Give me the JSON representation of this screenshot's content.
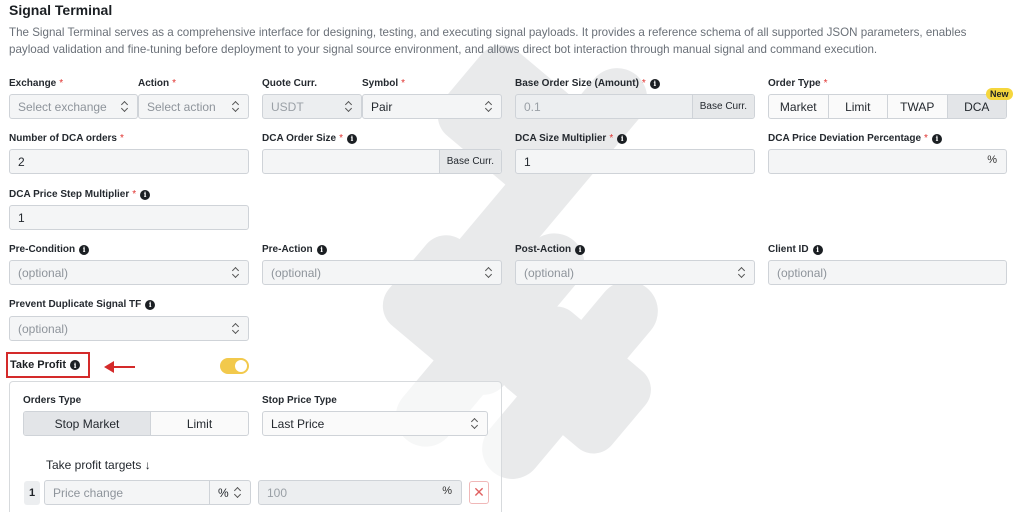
{
  "header": {
    "title": "Signal Terminal",
    "description": "The Signal Terminal serves as a comprehensive interface for designing, testing, and executing signal payloads. It provides a reference schema of all supported JSON parameters, enables payload validation and fine-tuning before deployment to your signal source environment, and allows direct bot interaction through manual signal and command execution."
  },
  "form": {
    "exchange": {
      "label": "Exchange",
      "required": "*",
      "placeholder": "Select exchange"
    },
    "action": {
      "label": "Action",
      "required": "*",
      "placeholder": "Select action"
    },
    "quote_curr": {
      "label": "Quote Curr.",
      "value": "USDT"
    },
    "symbol": {
      "label": "Symbol",
      "required": "*",
      "value": "Pair"
    },
    "base_order_size": {
      "label": "Base Order Size (Amount)",
      "required": "*",
      "placeholder": "0.1",
      "suffix": "Base Curr."
    },
    "order_type": {
      "label": "Order Type",
      "required": "*",
      "options": [
        "Market",
        "Limit",
        "TWAP",
        "DCA"
      ],
      "selected": "DCA",
      "badge": "New"
    },
    "dca_orders": {
      "label": "Number of DCA orders",
      "required": "*",
      "value": "2"
    },
    "dca_order_size": {
      "label": "DCA Order Size",
      "required": "*",
      "suffix": "Base Curr."
    },
    "dca_size_multiplier": {
      "label": "DCA Size Multiplier",
      "required": "*",
      "value": "1"
    },
    "dca_price_deviation": {
      "label": "DCA Price Deviation Percentage",
      "required": "*",
      "unit": "%"
    },
    "dca_price_step": {
      "label": "DCA Price Step Multiplier",
      "required": "*",
      "value": "1"
    },
    "pre_condition": {
      "label": "Pre-Condition",
      "placeholder": "(optional)"
    },
    "pre_action": {
      "label": "Pre-Action",
      "placeholder": "(optional)"
    },
    "post_action": {
      "label": "Post-Action",
      "placeholder": "(optional)"
    },
    "client_id": {
      "label": "Client ID",
      "placeholder": "(optional)"
    },
    "prevent_duplicate": {
      "label": "Prevent Duplicate Signal TF",
      "placeholder": "(optional)"
    }
  },
  "take_profit": {
    "label": "Take Profit",
    "enabled": true,
    "orders_type": {
      "label": "Orders Type",
      "options": [
        "Stop Market",
        "Limit"
      ],
      "selected": "Stop Market"
    },
    "stop_price_type": {
      "label": "Stop Price Type",
      "value": "Last Price"
    },
    "targets_label": "Take profit targets ↓",
    "rows": [
      {
        "index": "1",
        "price_placeholder": "Price change",
        "unit": "%",
        "amount_placeholder": "100",
        "amount_unit": "%"
      }
    ]
  },
  "colors": {
    "required": "#e0322f",
    "toggle": "#f2c94c",
    "badge": "#f5d63d",
    "highlight": "#d42a2a"
  }
}
